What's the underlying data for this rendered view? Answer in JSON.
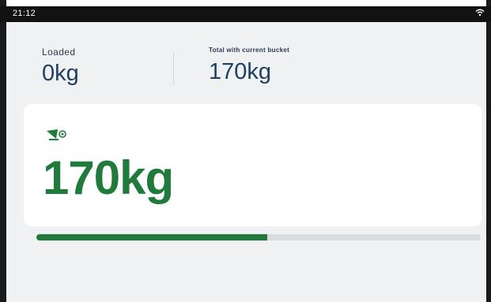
{
  "statusbar": {
    "time": "21:12",
    "wifi_icon": "wifi-icon"
  },
  "stats": {
    "loaded": {
      "label": "Loaded",
      "value": "0kg"
    },
    "total": {
      "label": "Total with current bucket",
      "value": "170kg"
    }
  },
  "current_bucket": {
    "icon": "bucket-icon",
    "weight": "170kg"
  },
  "progress": {
    "fraction": 0.52
  },
  "colors": {
    "accent_green": "#1f7a3b",
    "value_blue": "#1e3e63",
    "status_bar": "#121212",
    "screen_bg": "#f0f1f2"
  }
}
